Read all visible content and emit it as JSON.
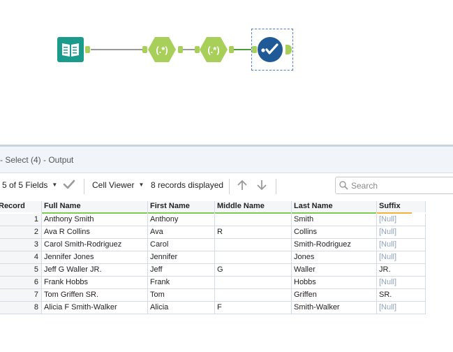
{
  "canvas": {
    "tools": [
      {
        "name": "input-data-tool",
        "label": "Input Data"
      },
      {
        "name": "regex-tool-1",
        "label": "(.*)"
      },
      {
        "name": "regex-tool-2",
        "label": "(.*)"
      },
      {
        "name": "select-tool",
        "label": "Select"
      }
    ]
  },
  "results": {
    "title": "- Select (4) - Output",
    "fields_label": "5 of 5 Fields",
    "cell_viewer_label": "Cell Viewer",
    "records_label": "8 records displayed",
    "search_placeholder": "Search"
  },
  "table": {
    "columns": [
      "Record",
      "Full Name",
      "First Name",
      "Middle Name",
      "Last Name",
      "Suffix"
    ],
    "rows": [
      [
        "1",
        "Anthony Smith",
        "Anthony",
        "",
        "Smith",
        "[Null]"
      ],
      [
        "2",
        "Ava R Collins",
        "Ava",
        "R",
        "Collins",
        "[Null]"
      ],
      [
        "3",
        "Carol Smith-Rodriguez",
        "Carol",
        "",
        "Smith-Rodriguez",
        "[Null]"
      ],
      [
        "4",
        "Jennifer Jones",
        "Jennifer",
        "",
        "Jones",
        "[Null]"
      ],
      [
        "5",
        "Jeff G Waller JR.",
        "Jeff",
        "G",
        "Waller",
        "JR."
      ],
      [
        "6",
        "Frank Hobbs",
        "Frank",
        "",
        "Hobbs",
        "[Null]"
      ],
      [
        "7",
        "Tom Griffen SR.",
        "Tom",
        "",
        "Griffen",
        "SR."
      ],
      [
        "8",
        "Alicia F Smith-Walker",
        "Alicia",
        "F",
        "Smith-Walker",
        "[Null]"
      ]
    ],
    "null_value": "[Null]"
  },
  "colors": {
    "input_tool": "#1a9b8c",
    "regex_tool": "#a7cf5a",
    "select_tool": "#1f5a97",
    "header_bar_green": "#7ecb54",
    "header_bar_orange": "#f2b33d"
  }
}
